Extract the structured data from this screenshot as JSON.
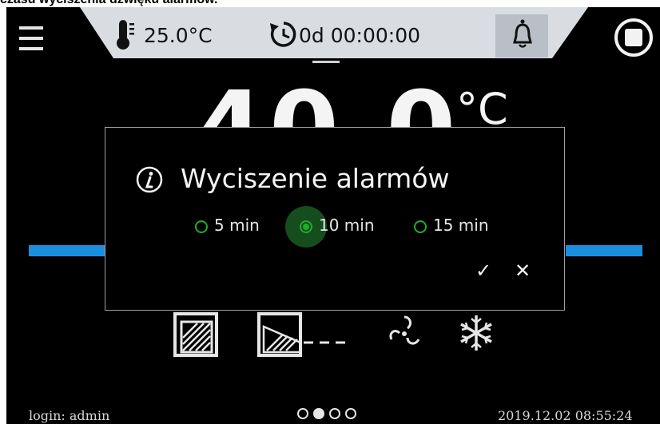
{
  "caption": "czasu wyciszenia dźwięku alarmów.",
  "topbar": {
    "menu_icon": "hamburger-menu-icon",
    "ambient_temperature": "25.0°C",
    "timer": "0d 00:00:00",
    "bell_icon": "bell-icon",
    "stop_icon": "stop-icon"
  },
  "main": {
    "temperature": "40.0",
    "unit": "°C"
  },
  "dialog": {
    "title": "Wyciszenie alarmów",
    "options": [
      {
        "label": "5 min",
        "selected": false
      },
      {
        "label": "10 min",
        "selected": true
      },
      {
        "label": "15 min",
        "selected": false
      }
    ],
    "confirm_label": "✓",
    "cancel_label": "✕"
  },
  "footer": {
    "login": "login: admin",
    "datetime": "2019.12.02  08:55:24",
    "pages": 4,
    "active_page": 2
  },
  "colors": {
    "accent_blue": "#1a8fe0",
    "radio_green": "#1fae2a",
    "topbar_gray": "#d9dde1"
  }
}
